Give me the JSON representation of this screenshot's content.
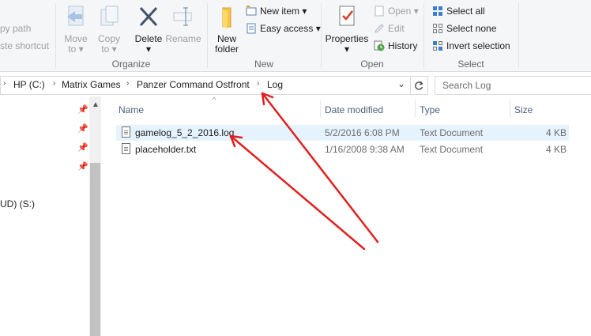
{
  "ribbon": {
    "clipboard": {
      "copy_path": "py path",
      "paste_shortcut": "ste shortcut"
    },
    "organize": {
      "group_label": "Organize",
      "move_to": "Move",
      "move_to_sub": "to ▾",
      "copy_to": "Copy",
      "copy_to_sub": "to ▾",
      "delete": "Delete",
      "delete_sub": "▾",
      "rename": "Rename"
    },
    "new": {
      "group_label": "New",
      "new_item": "New item ▾",
      "easy_access": "Easy access ▾",
      "new_folder": "New",
      "new_folder_sub": "folder"
    },
    "open": {
      "group_label": "Open",
      "properties": "Properties",
      "properties_sub": "▾",
      "open": "Open ▾",
      "edit": "Edit",
      "history": "History"
    },
    "select": {
      "group_label": "Select",
      "select_all": "Select all",
      "select_none": "Select none",
      "invert_selection": "Invert selection"
    }
  },
  "address": {
    "crumbs": [
      "HP (C:)",
      "Matrix Games",
      "Panzer Command Ostfront",
      "Log"
    ],
    "search_placeholder": "Search Log"
  },
  "nav": {
    "drive_label": "UD) (S:)"
  },
  "columns": {
    "name": "Name",
    "date": "Date modified",
    "type": "Type",
    "size": "Size"
  },
  "files": [
    {
      "name": "gamelog_5_2_2016.log",
      "date": "5/2/2016 6:08 PM",
      "type": "Text Document",
      "size": "4 KB"
    },
    {
      "name": "placeholder.txt",
      "date": "1/16/2008 9:38 AM",
      "type": "Text Document",
      "size": "4 KB"
    }
  ],
  "colors": {
    "selected_row": "#e5f3ff",
    "annotation_arrow": "#e02020",
    "header_text": "#4c607a"
  }
}
